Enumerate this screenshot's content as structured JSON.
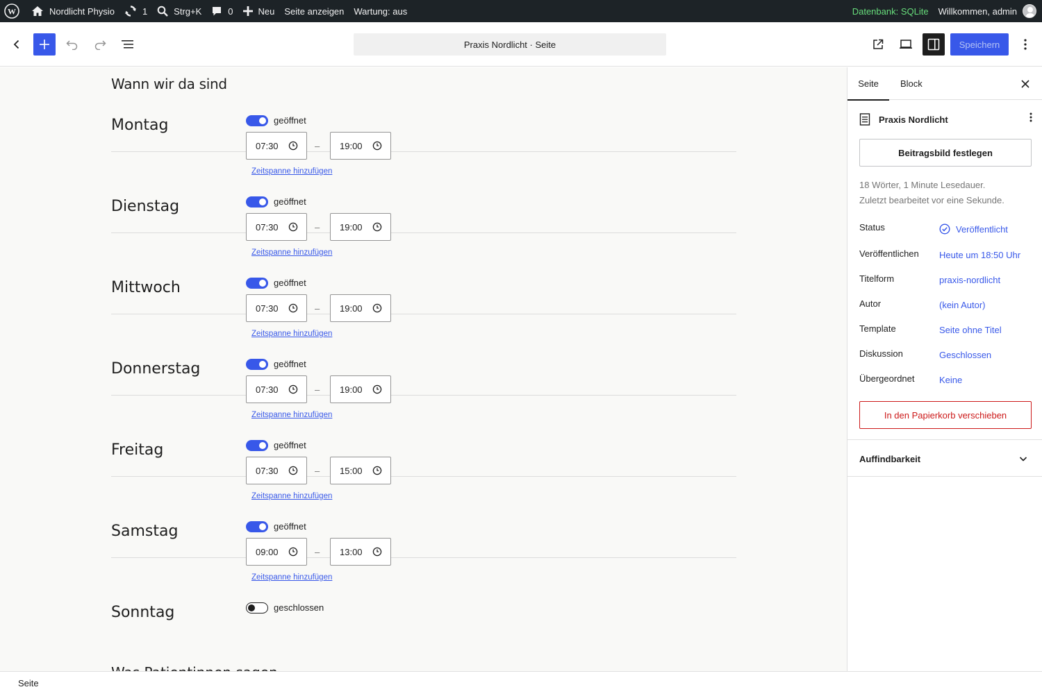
{
  "adminbar": {
    "site_name": "Nordlicht Physio",
    "updates_count": "1",
    "search_shortcut": "Strg+K",
    "comments_count": "0",
    "new_label": "Neu",
    "view_page": "Seite anzeigen",
    "maintenance": "Wartung: aus",
    "database": "Datenbank: SQLite",
    "welcome": "Willkommen, admin"
  },
  "header": {
    "document_title": "Praxis Nordlicht · Seite",
    "save_label": "Speichern"
  },
  "content": {
    "heading": "Wann wir da sind",
    "next_heading": "Was Patientinnen sagen",
    "add_span_label": "Zeitspanne hinzufügen",
    "days": [
      {
        "name": "Montag",
        "status": "geöffnet",
        "open": true,
        "from": "07:30",
        "to": "19:00"
      },
      {
        "name": "Dienstag",
        "status": "geöffnet",
        "open": true,
        "from": "07:30",
        "to": "19:00"
      },
      {
        "name": "Mittwoch",
        "status": "geöffnet",
        "open": true,
        "from": "07:30",
        "to": "19:00"
      },
      {
        "name": "Donnerstag",
        "status": "geöffnet",
        "open": true,
        "from": "07:30",
        "to": "19:00"
      },
      {
        "name": "Freitag",
        "status": "geöffnet",
        "open": true,
        "from": "07:30",
        "to": "15:00"
      },
      {
        "name": "Samstag",
        "status": "geöffnet",
        "open": true,
        "from": "09:00",
        "to": "13:00"
      },
      {
        "name": "Sonntag",
        "status": "geschlossen",
        "open": false,
        "from": "",
        "to": ""
      }
    ]
  },
  "sidebar": {
    "tab_page": "Seite",
    "tab_block": "Block",
    "page_title": "Praxis Nordlicht",
    "featured_image": "Beitragsbild festlegen",
    "stats_line1": "18 Wörter, 1 Minute Lesedauer.",
    "stats_line2": "Zuletzt bearbeitet vor eine Sekunde.",
    "props": [
      {
        "key": "Status",
        "value": "Veröffentlicht"
      },
      {
        "key": "Veröffentlichen",
        "value": "Heute um 18:50 Uhr"
      },
      {
        "key": "Titelform",
        "value": "praxis-nordlicht"
      },
      {
        "key": "Autor",
        "value": "(kein Autor)"
      },
      {
        "key": "Template",
        "value": "Seite ohne Titel"
      },
      {
        "key": "Diskussion",
        "value": "Geschlossen"
      },
      {
        "key": "Übergeordnet",
        "value": "Keine"
      }
    ],
    "trash": "In den Papierkorb verschieben",
    "discoverability": "Auffindbarkeit"
  },
  "footer": {
    "breadcrumb": "Seite"
  },
  "colors": {
    "accent": "#3858e9",
    "danger": "#cc1818",
    "adminbar": "#1d2327",
    "db_green": "#68de7c"
  }
}
